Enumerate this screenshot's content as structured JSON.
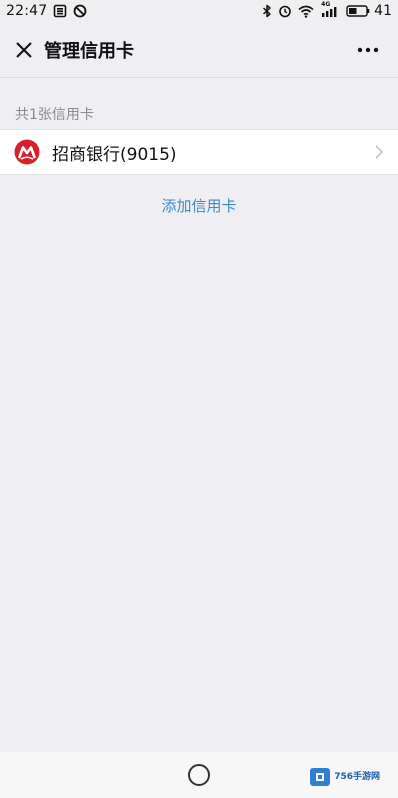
{
  "status_bar": {
    "time": "22:47",
    "network_label": "4G",
    "battery_level": "41",
    "icons": [
      "sim-icon",
      "dnd-icon",
      "bluetooth-icon",
      "alarm-icon",
      "wifi-icon",
      "signal-icon",
      "battery-icon"
    ]
  },
  "header": {
    "title": "管理信用卡",
    "close_icon": "close-icon",
    "more_icon": "more-icon"
  },
  "section": {
    "label": "共1张信用卡"
  },
  "cards": [
    {
      "bank_name": "招商银行(9015)",
      "logo": "cmb-logo",
      "logo_color": "#d8202a"
    }
  ],
  "add_link": {
    "label": "添加信用卡",
    "color": "#3b8bc8"
  },
  "nav_bar": {
    "home_icon": "home-icon"
  },
  "watermark": {
    "text": "756手游网"
  }
}
